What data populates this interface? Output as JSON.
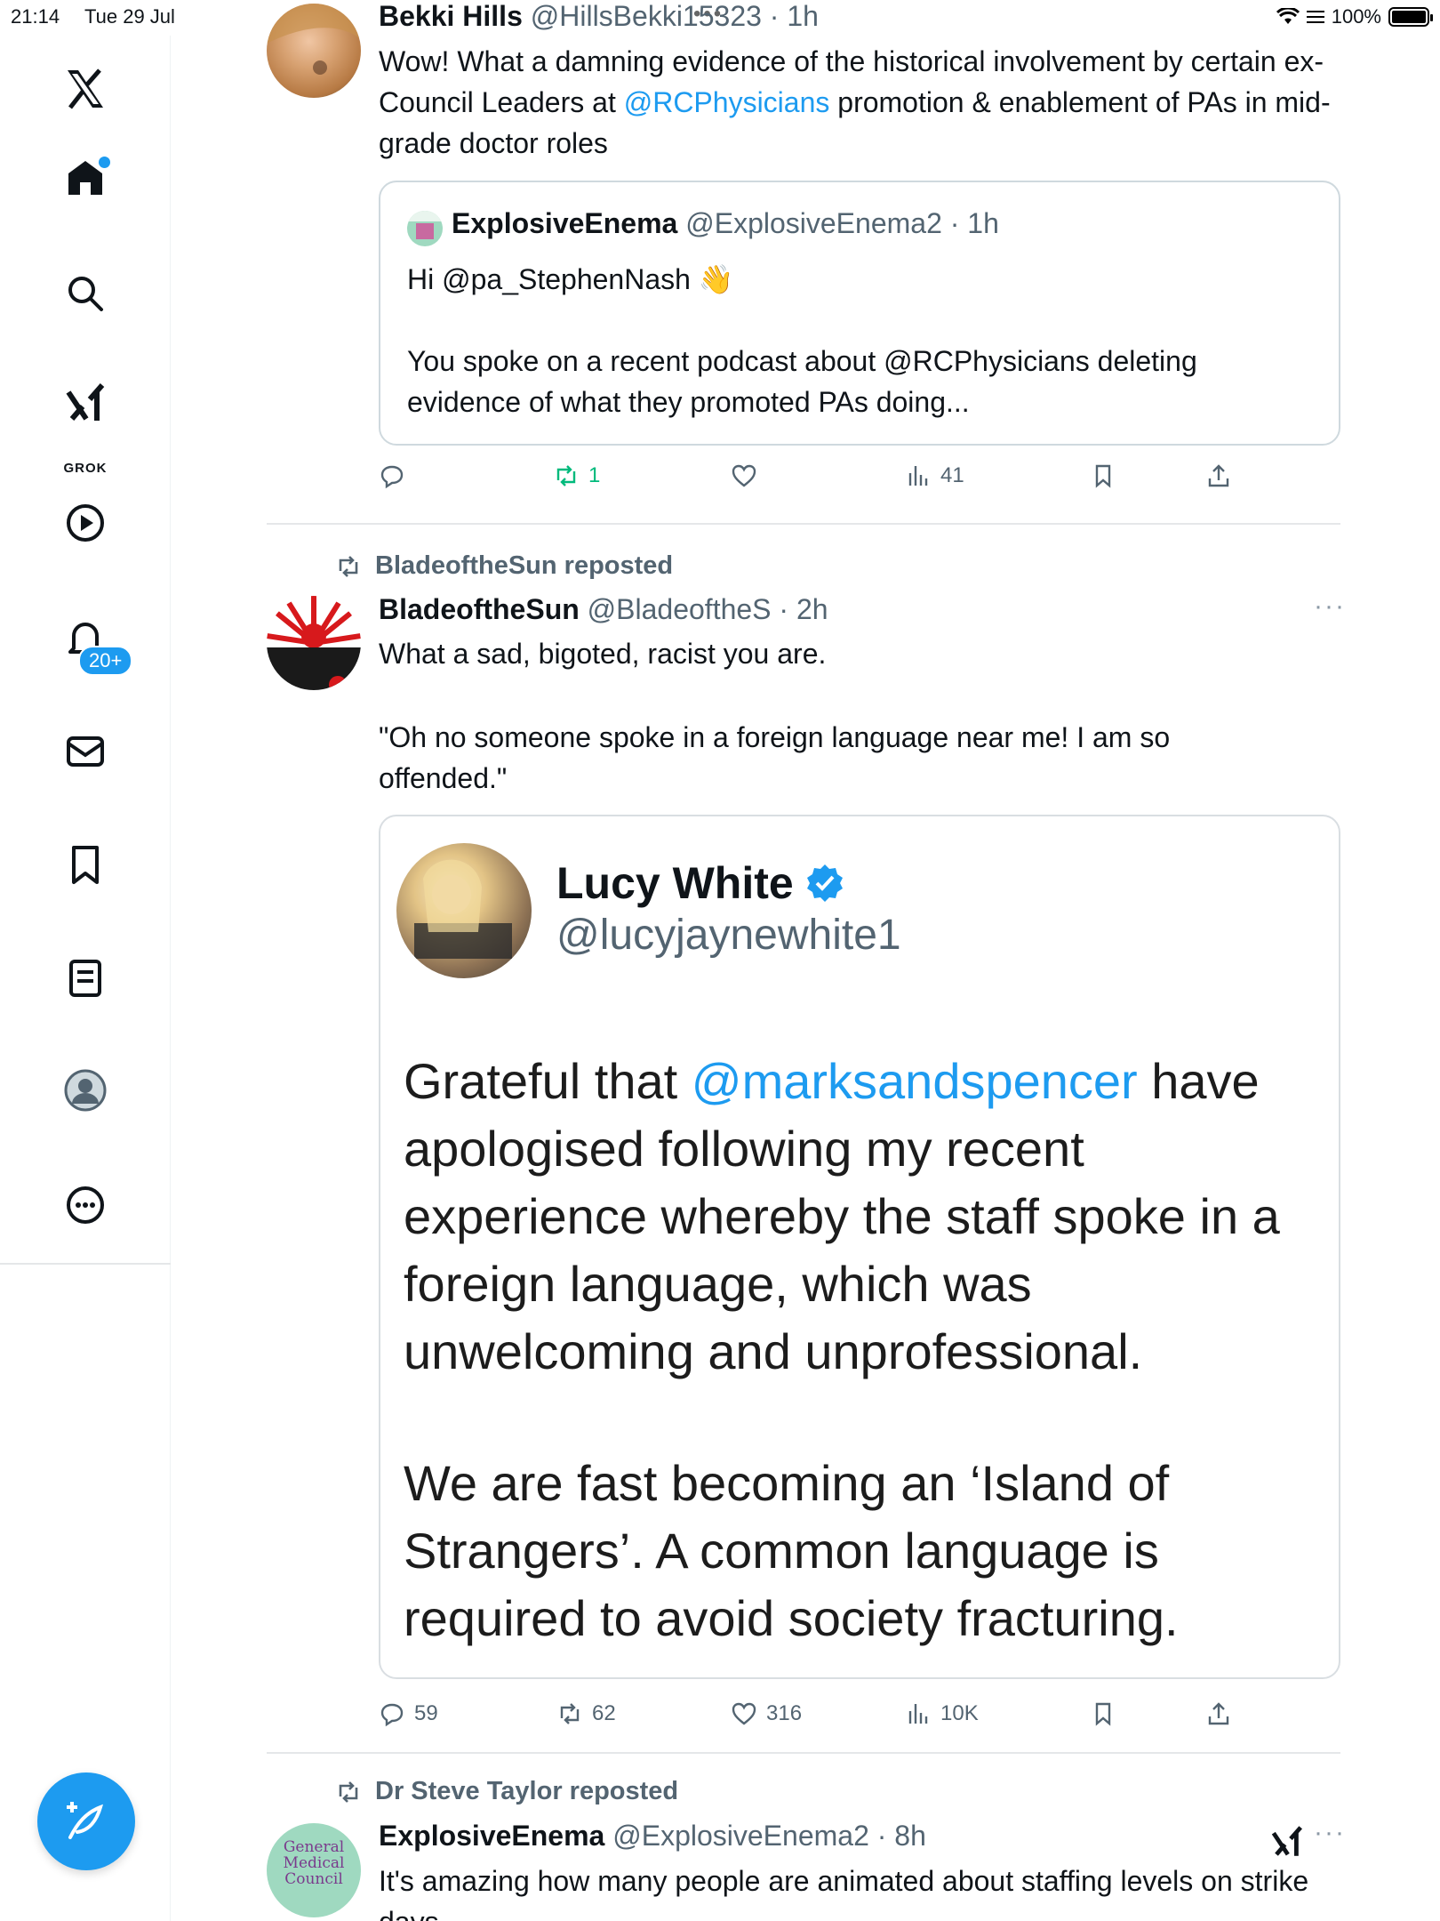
{
  "status_bar": {
    "time": "21:14",
    "date": "Tue 29 Jul",
    "battery": "100%"
  },
  "sidebar": {
    "grok_label": "GROK",
    "notifications_badge": "20+"
  },
  "colors": {
    "accent": "#1d9bf0",
    "text": "#0f1419",
    "secondary": "#536471",
    "repost_active": "#00ba7c"
  },
  "tweet1": {
    "name": "Bekki Hills",
    "handle": "@HillsBekki15323",
    "time": "· 1h",
    "text_1": "Wow! What a damning evidence of the historical involvement by certain ex-Council Leaders at ",
    "mention": "@RCPhysicians",
    "text_2": " promotion & enablement of PAs in mid-grade doctor roles",
    "quote": {
      "name": "ExplosiveEnema",
      "handle": "@ExplosiveEnema2",
      "time": "· 1h",
      "line1": "Hi @pa_StephenNash 👋",
      "line2": "You spoke on a recent podcast about @RCPhysicians deleting evidence of what they promoted PAs doing..."
    },
    "actions": {
      "reposts": "1",
      "views": "41"
    }
  },
  "tweet2": {
    "reposted_by": "BladeoftheSun reposted",
    "name": "BladeoftheSun",
    "handle": "@BladeoftheS",
    "time": "· 2h",
    "more": "···",
    "text_1": "What a sad, bigoted, racist you are.",
    "text_2": "\"Oh no someone spoke in a foreign language near me! I am so offended.\"",
    "quote_image": {
      "name": "Lucy White",
      "handle": "@lucyjaynewhite1",
      "para1_pre": "Grateful that ",
      "para1_mention": "@marksandspencer",
      "para1_post": " have apologised following my recent experience whereby the staff spoke in a foreign language, which was unwelcoming and unprofessional.",
      "para2": "We are fast becoming an ‘Island of Strangers’. A common language is required to avoid society fracturing."
    },
    "actions": {
      "replies": "59",
      "reposts": "62",
      "likes": "316",
      "views": "10K"
    }
  },
  "tweet3": {
    "reposted_by": "Dr Steve Taylor reposted",
    "name": "ExplosiveEnema",
    "handle": "@ExplosiveEnema2",
    "time": "· 8h",
    "more": "···",
    "avatar_text": "General Medical Council",
    "text": "It's amazing how many people are animated about staffing levels on strike days"
  }
}
